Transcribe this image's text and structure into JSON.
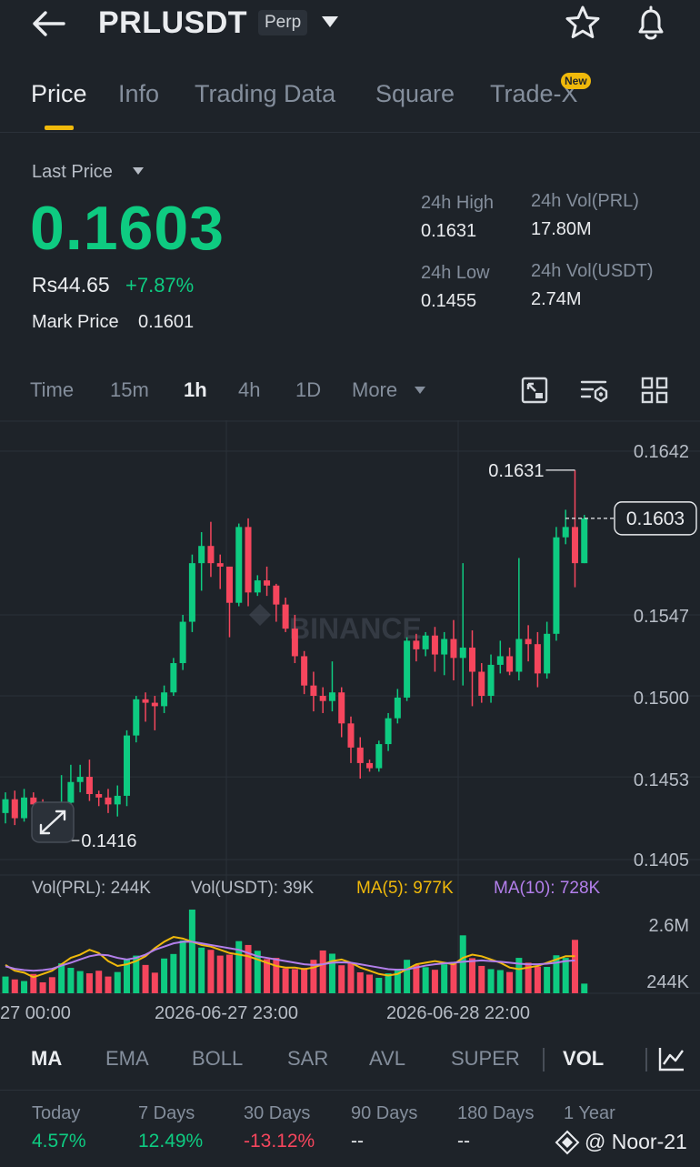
{
  "header": {
    "symbol": "PRLUSDT",
    "badge": "Perp"
  },
  "tabs": [
    {
      "label": "Price"
    },
    {
      "label": "Info"
    },
    {
      "label": "Trading Data"
    },
    {
      "label": "Square"
    },
    {
      "label": "Trade-X"
    }
  ],
  "new_badge": "New",
  "price": {
    "label": "Last Price",
    "last": "0.1603",
    "fiat": "Rs44.65",
    "change": "+7.87%",
    "mark_label": "Mark Price",
    "mark_value": "0.1601"
  },
  "stats": {
    "high_label": "24h High",
    "high": "0.1631",
    "low_label": "24h Low",
    "low": "0.1455",
    "vol_base_label": "24h Vol(PRL)",
    "vol_base": "17.80M",
    "vol_quote_label": "24h Vol(USDT)",
    "vol_quote": "2.74M"
  },
  "intervals": [
    "Time",
    "15m",
    "1h",
    "4h",
    "1D",
    "More"
  ],
  "colors": {
    "up": "#0ecb81",
    "down": "#f6465d",
    "accent": "#f0b90b",
    "ma5": "#f0b90b",
    "ma10": "#b37feb",
    "background": "#1e2329"
  },
  "chart_data": {
    "type": "candlestick",
    "price_axis_labels": [
      "0.1642",
      "0.1547",
      "0.1500",
      "0.1453",
      "0.1405"
    ],
    "ylim": [
      0.1405,
      0.1642
    ],
    "current_price": "0.1603",
    "high_annotation": "0.1631",
    "low_annotation": "0.1416",
    "watermark": "BINANCE",
    "time_labels": [
      "27 00:00",
      "2026-06-27 23:00",
      "2026-06-28 22:00"
    ],
    "volume_info": {
      "vol_base": "Vol(PRL): 244K",
      "vol_quote": "Vol(USDT): 39K",
      "ma5": "MA(5): 977K",
      "ma10": "MA(10): 728K"
    },
    "volume_axis_labels": [
      "2.6M",
      "244K"
    ],
    "volume_max": 2600,
    "candles": [
      [
        0.1432,
        0.144,
        0.1426,
        0.1444
      ],
      [
        0.144,
        0.1429,
        0.1425,
        0.1445
      ],
      [
        0.1429,
        0.1441,
        0.1427,
        0.1446
      ],
      [
        0.1441,
        0.1437,
        0.1432,
        0.1444
      ],
      [
        0.1437,
        0.1428,
        0.1418,
        0.144
      ],
      [
        0.1428,
        0.1423,
        0.1416,
        0.1433
      ],
      [
        0.1423,
        0.1438,
        0.142,
        0.1454
      ],
      [
        0.1438,
        0.145,
        0.1433,
        0.146
      ],
      [
        0.145,
        0.1453,
        0.1444,
        0.146
      ],
      [
        0.1453,
        0.1443,
        0.1439,
        0.1463
      ],
      [
        0.1443,
        0.1441,
        0.1436,
        0.1445
      ],
      [
        0.1441,
        0.1437,
        0.1432,
        0.1446
      ],
      [
        0.1437,
        0.1442,
        0.143,
        0.1448
      ],
      [
        0.1442,
        0.1477,
        0.1436,
        0.148
      ],
      [
        0.1477,
        0.1498,
        0.1473,
        0.15
      ],
      [
        0.1498,
        0.1496,
        0.1485,
        0.1502
      ],
      [
        0.1496,
        0.1494,
        0.148,
        0.15
      ],
      [
        0.1494,
        0.1502,
        0.149,
        0.1506
      ],
      [
        0.1502,
        0.1519,
        0.15,
        0.1522
      ],
      [
        0.1519,
        0.1543,
        0.1515,
        0.1547
      ],
      [
        0.1543,
        0.1577,
        0.1537,
        0.1582
      ],
      [
        0.1577,
        0.1587,
        0.1561,
        0.1595
      ],
      [
        0.1587,
        0.1577,
        0.1569,
        0.1601
      ],
      [
        0.1577,
        0.1575,
        0.1562,
        0.1582
      ],
      [
        0.1575,
        0.1554,
        0.1534,
        0.1565
      ],
      [
        0.1554,
        0.1598,
        0.1552,
        0.16
      ],
      [
        0.1598,
        0.156,
        0.1552,
        0.1603
      ],
      [
        0.156,
        0.1567,
        0.1558,
        0.157
      ],
      [
        0.1567,
        0.1564,
        0.1558,
        0.1575
      ],
      [
        0.1564,
        0.1553,
        0.1543,
        0.1565
      ],
      [
        0.1553,
        0.1539,
        0.1537,
        0.1557
      ],
      [
        0.1539,
        0.1523,
        0.1519,
        0.1547
      ],
      [
        0.1523,
        0.1506,
        0.1501,
        0.1526
      ],
      [
        0.1506,
        0.15,
        0.1491,
        0.1514
      ],
      [
        0.15,
        0.1497,
        0.149,
        0.1505
      ],
      [
        0.1497,
        0.1502,
        0.1491,
        0.152
      ],
      [
        0.1502,
        0.1484,
        0.1476,
        0.1505
      ],
      [
        0.1484,
        0.147,
        0.1461,
        0.1488
      ],
      [
        0.147,
        0.1461,
        0.1452,
        0.1476
      ],
      [
        0.1461,
        0.1458,
        0.1456,
        0.1463
      ],
      [
        0.1458,
        0.1472,
        0.1456,
        0.1474
      ],
      [
        0.1472,
        0.1487,
        0.1468,
        0.149
      ],
      [
        0.1487,
        0.1499,
        0.1484,
        0.1504
      ],
      [
        0.1499,
        0.1532,
        0.1497,
        0.1534
      ],
      [
        0.1532,
        0.1527,
        0.152,
        0.1536
      ],
      [
        0.1527,
        0.1535,
        0.1523,
        0.1537
      ],
      [
        0.1535,
        0.1524,
        0.1514,
        0.154
      ],
      [
        0.1524,
        0.1533,
        0.1512,
        0.1537
      ],
      [
        0.1533,
        0.1522,
        0.1509,
        0.1544
      ],
      [
        0.1522,
        0.1528,
        0.1506,
        0.1577
      ],
      [
        0.1528,
        0.1514,
        0.1494,
        0.1538
      ],
      [
        0.1514,
        0.15,
        0.1496,
        0.1519
      ],
      [
        0.15,
        0.1518,
        0.1496,
        0.1524
      ],
      [
        0.1518,
        0.1523,
        0.1513,
        0.1532
      ],
      [
        0.1523,
        0.1514,
        0.1512,
        0.1528
      ],
      [
        0.1514,
        0.1533,
        0.1509,
        0.158
      ],
      [
        0.1533,
        0.153,
        0.152,
        0.1541
      ],
      [
        0.153,
        0.1513,
        0.1505,
        0.1537
      ],
      [
        0.1513,
        0.1536,
        0.151,
        0.1543
      ],
      [
        0.1536,
        0.1592,
        0.1532,
        0.1598
      ],
      [
        0.1592,
        0.1598,
        0.1588,
        0.1608
      ],
      [
        0.1598,
        0.1577,
        0.1563,
        0.1631
      ],
      [
        0.1577,
        0.1603,
        0.1577,
        0.1605
      ]
    ],
    "volumes": [
      520,
      430,
      380,
      600,
      340,
      500,
      930,
      790,
      690,
      620,
      700,
      520,
      660,
      1050,
      1170,
      880,
      640,
      1080,
      1220,
      1640,
      2600,
      1420,
      1350,
      1170,
      1200,
      1620,
      1500,
      1320,
      1060,
      1100,
      770,
      750,
      790,
      1040,
      1330,
      1230,
      870,
      950,
      650,
      580,
      480,
      620,
      760,
      1040,
      880,
      810,
      730,
      900,
      940,
      1800,
      1090,
      850,
      750,
      720,
      660,
      1100,
      950,
      830,
      820,
      1180,
      1100,
      1660,
      300
    ],
    "ma5": [
      880,
      700,
      640,
      500,
      600,
      700,
      900,
      1100,
      1200,
      1350,
      1250,
      1000,
      850,
      900,
      1000,
      1150,
      1400,
      1600,
      1750,
      1700,
      1600,
      1500,
      1450,
      1350,
      1250,
      1200,
      1150,
      1050,
      950,
      850,
      800,
      800,
      750,
      800,
      900,
      1000,
      1050,
      950,
      800,
      700,
      600,
      550,
      600,
      750,
      900,
      950,
      1000,
      950,
      900,
      1100,
      1200,
      1150,
      1050,
      950,
      800,
      750,
      800,
      850,
      950,
      1050,
      1150,
      1150
    ],
    "ma10": [
      840,
      760,
      720,
      700,
      720,
      760,
      860,
      950,
      1050,
      1150,
      1200,
      1180,
      1100,
      1050,
      1100,
      1200,
      1350,
      1450,
      1550,
      1600,
      1600,
      1550,
      1500,
      1450,
      1400,
      1350,
      1250,
      1150,
      1100,
      1050,
      1000,
      950,
      900,
      880,
      900,
      950,
      960,
      950,
      900,
      850,
      800,
      750,
      730,
      740,
      800,
      860,
      900,
      930,
      950,
      980,
      1000,
      1020,
      1000,
      980,
      950,
      920,
      900,
      900,
      920,
      950,
      1000,
      1020
    ]
  },
  "indicators": [
    "MA",
    "EMA",
    "BOLL",
    "SAR",
    "AVL",
    "SUPER",
    "VOL"
  ],
  "performance": [
    {
      "label": "Today",
      "value": "4.57%",
      "tone": "up"
    },
    {
      "label": "7 Days",
      "value": "12.49%",
      "tone": "up"
    },
    {
      "label": "30 Days",
      "value": "-13.12%",
      "tone": "down"
    },
    {
      "label": "90 Days",
      "value": "--",
      "tone": "none"
    },
    {
      "label": "180 Days",
      "value": "--",
      "tone": "none"
    },
    {
      "label": "1 Year",
      "value": "",
      "tone": "none"
    }
  ],
  "watermark": "@ Noor-21"
}
